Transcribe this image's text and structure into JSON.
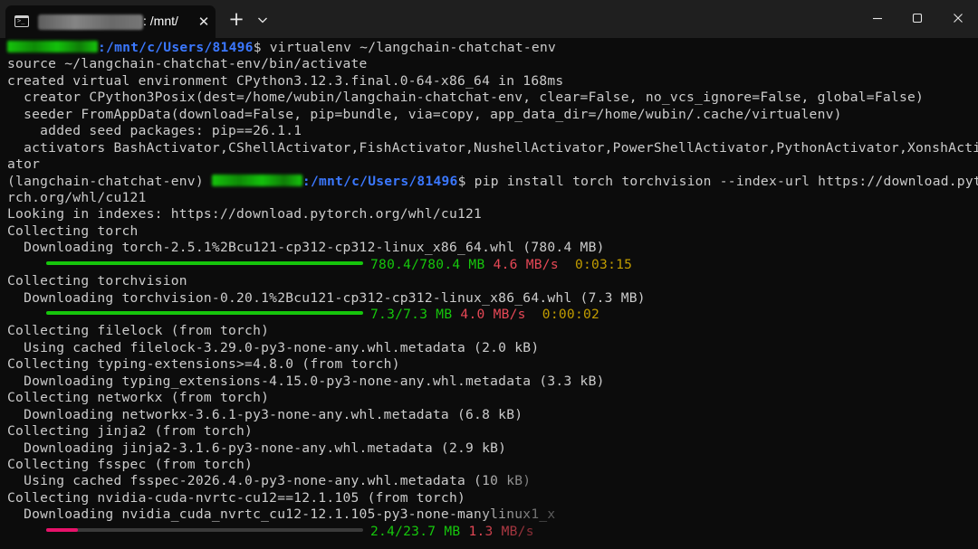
{
  "window": {
    "tab_title": ": /mnt/",
    "tab_close_glyph": "✕",
    "new_tab_glyph": "+",
    "icons": [
      "terminal-icon",
      "close-icon",
      "plus-icon",
      "chevron-down-icon",
      "minimize-icon",
      "maximize-icon",
      "close-window-icon"
    ]
  },
  "colors": {
    "background": "#0c0c0c",
    "titlebar": "#1f1f1f",
    "text": "#cccccc",
    "path_blue": "#3b78ff",
    "green": "#16c60c",
    "red": "#e74856",
    "yellow": "#c19c00",
    "progress_pink": "#e7126a"
  },
  "terminal": {
    "l1_path": ":/mnt/c/Users/81496",
    "l1_cmd": "$ virtualenv ~/langchain-chatchat-env",
    "l2": "source ~/langchain-chatchat-env/bin/activate",
    "l3": "created virtual environment CPython3.12.3.final.0-64-x86_64 in 168ms",
    "l4": "  creator CPython3Posix(dest=/home/wubin/langchain-chatchat-env, clear=False, no_vcs_ignore=False, global=False)",
    "l5": "  seeder FromAppData(download=False, pip=bundle, via=copy, app_data_dir=/home/wubin/.cache/virtualenv)",
    "l6": "    added seed packages: pip==26.1.1",
    "l7": "  activators BashActivator,CShellActivator,FishActivator,NushellActivator,PowerShellActivator,PythonActivator,XonshActiv",
    "l8": "ator",
    "l9_prefix": "(langchain-chatchat-env) ",
    "l9_path": ":/mnt/c/Users/81496",
    "l9_cmd": "$ pip install torch torchvision --index-url https://download.pyto",
    "l10": "rch.org/whl/cu121",
    "l11": "Looking in indexes: https://download.pytorch.org/whl/cu121",
    "l12": "Collecting torch",
    "l13": "  Downloading torch-2.5.1%2Bcu121-cp312-cp312-linux_x86_64.whl (780.4 MB)",
    "p1": {
      "size": "780.4/780.4 MB",
      "speed": "4.6 MB/s",
      "eta": "0:03:15",
      "progress": 1.0
    },
    "l15": "Collecting torchvision",
    "l16": "  Downloading torchvision-0.20.1%2Bcu121-cp312-cp312-linux_x86_64.whl (7.3 MB)",
    "p2": {
      "size": "7.3/7.3 MB",
      "speed": "4.0 MB/s",
      "eta": "0:00:02",
      "progress": 1.0
    },
    "l18": "Collecting filelock (from torch)",
    "l19": "  Using cached filelock-3.29.0-py3-none-any.whl.metadata (2.0 kB)",
    "l20": "Collecting typing-extensions>=4.8.0 (from torch)",
    "l21": "  Downloading typing_extensions-4.15.0-py3-none-any.whl.metadata (3.3 kB)",
    "l22": "Collecting networkx (from torch)",
    "l23": "  Downloading networkx-3.6.1-py3-none-any.whl.metadata (6.8 kB)",
    "l24": "Collecting jinja2 (from torch)",
    "l25": "  Downloading jinja2-3.1.6-py3-none-any.whl.metadata (2.9 kB)",
    "l26": "Collecting fsspec (from torch)",
    "l27": "  Using cached fsspec-2026.4.0-py3-none-any.whl.metadata (10 kB)",
    "l28": "Collecting nvidia-cuda-nvrtc-cu12==12.1.105 (from torch)",
    "l29": "  Downloading nvidia_cuda_nvrtc_cu12-12.1.105-py3-none-manylinux1_x",
    "p3": {
      "size": "2.4/23.7 MB",
      "speed": "1.3 MB/s",
      "progress": 0.1
    }
  }
}
